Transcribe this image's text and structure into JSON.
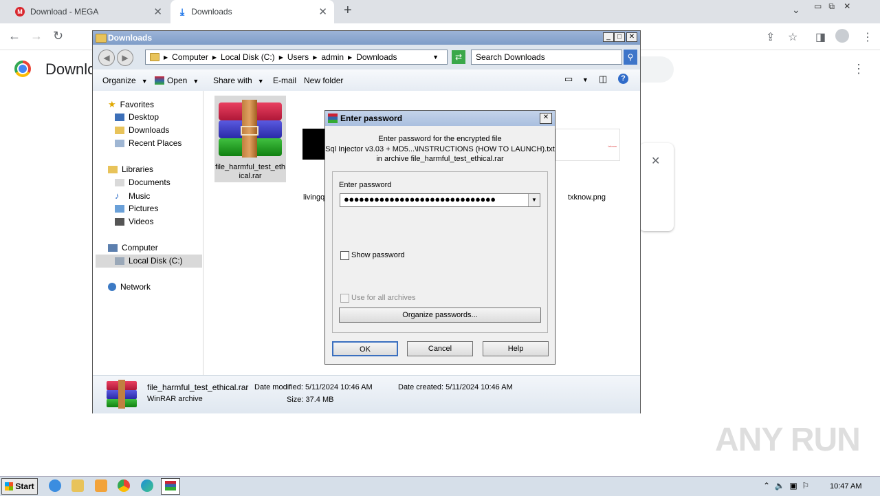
{
  "browser": {
    "tabs": [
      {
        "title": "Download - MEGA"
      },
      {
        "title": "Downloads"
      }
    ],
    "page_title": "Downloads"
  },
  "explorer": {
    "title": "Downloads",
    "breadcrumb": [
      "Computer",
      "Local Disk (C:)",
      "Users",
      "admin",
      "Downloads"
    ],
    "search_placeholder": "Search Downloads",
    "commands": [
      "Organize",
      "Open",
      "Share with",
      "E-mail",
      "New folder"
    ],
    "nav": {
      "favorites": "Favorites",
      "desktop": "Desktop",
      "downloads": "Downloads",
      "recent": "Recent Places",
      "libraries": "Libraries",
      "documents": "Documents",
      "music": "Music",
      "pictures": "Pictures",
      "videos": "Videos",
      "computer": "Computer",
      "localdisk": "Local Disk (C:)",
      "network": "Network"
    },
    "files": [
      {
        "name": "file_harmful_test_ethical.rar"
      },
      {
        "name": "livingq"
      },
      {
        "name": "txknow.png"
      }
    ],
    "details": {
      "name": "file_harmful_test_ethical.rar",
      "type": "WinRAR archive",
      "date_modified": "Date modified: 5/11/2024 10:46 AM",
      "size": "Size: 37.4 MB",
      "date_created": "Date created: 5/11/2024 10:46 AM"
    }
  },
  "dialog": {
    "title": "Enter password",
    "line1": "Enter password for the encrypted file",
    "line2": "Sql Injector v3.03 + MD5...\\INSTRUCTIONS (HOW TO LAUNCH).txt",
    "line3": "in archive file_harmful_test_ethical.rar",
    "field_label": "Enter password",
    "password_mask": "●●●●●●●●●●●●●●●●●●●●●●●●●●●●●●",
    "show_password": "Show password",
    "use_for_all": "Use for all archives",
    "organize": "Organize passwords...",
    "ok": "OK",
    "cancel": "Cancel",
    "help": "Help"
  },
  "taskbar": {
    "start": "Start",
    "time": "10:47 AM"
  },
  "watermark": "ANY RUN"
}
